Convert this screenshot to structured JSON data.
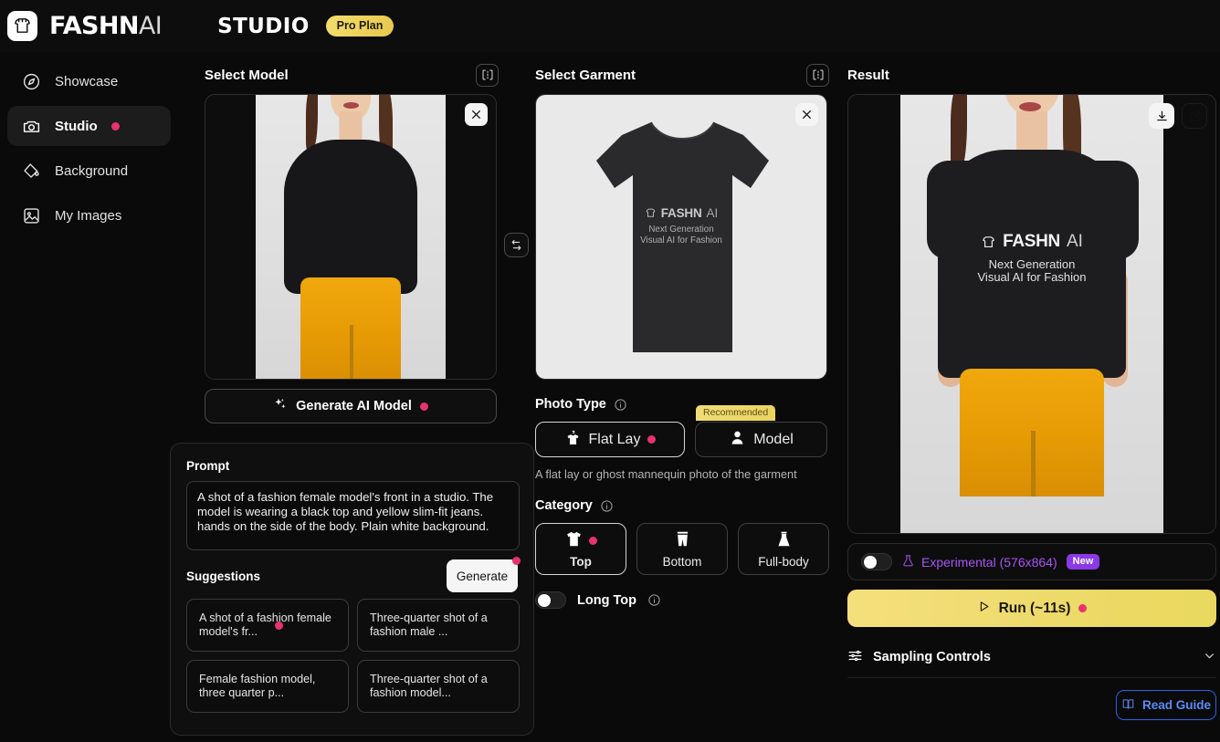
{
  "header": {
    "logo_icon": "shirt-logo-icon",
    "brand_bold": "FASHN",
    "brand_thin": "AI",
    "section": "STUDIO",
    "plan_badge": "Pro Plan"
  },
  "sidebar": {
    "items": [
      {
        "label": "Showcase",
        "icon": "compass-icon",
        "active": false,
        "dot": false
      },
      {
        "label": "Studio",
        "icon": "camera-icon",
        "active": true,
        "dot": true
      },
      {
        "label": "Background",
        "icon": "paint-bucket-icon",
        "active": false,
        "dot": false
      },
      {
        "label": "My Images",
        "icon": "image-icon",
        "active": false,
        "dot": false
      }
    ]
  },
  "model_panel": {
    "title": "Select Model",
    "frame_icon": "crop-frame-icon",
    "close_icon": "close-icon",
    "generate_button": "Generate AI Model",
    "sparkle_icon": "sparkles-icon"
  },
  "swap": {
    "icon": "swap-arrows-icon"
  },
  "prompt_panel": {
    "prompt_label": "Prompt",
    "prompt_value": "A shot of a fashion female model's front in a studio. The model is wearing a black top and yellow slim-fit jeans. hands on the side of the body. Plain white background.",
    "generate_label": "Generate",
    "suggestions_label": "Suggestions",
    "suggestions": [
      {
        "text": "A shot of a fashion female model's fr...",
        "dot": true
      },
      {
        "text": "Three-quarter shot of a fashion male ...",
        "dot": false
      },
      {
        "text": "Female fashion model, three quarter p...",
        "dot": false
      },
      {
        "text": "Three-quarter shot of a fashion model...",
        "dot": false
      }
    ]
  },
  "garment_panel": {
    "title": "Select Garment",
    "frame_icon": "crop-frame-icon",
    "close_icon": "close-icon",
    "garment_graphic": {
      "brand_bold": "FASHN",
      "brand_thin": "AI",
      "line1": "Next Generation",
      "line2": "Visual AI for Fashion"
    },
    "photo_type": {
      "label": "Photo Type",
      "info_icon": "info-icon",
      "options": [
        {
          "label": "Flat Lay",
          "icon": "hanger-shirt-icon",
          "selected": true,
          "dot": true,
          "tag": ""
        },
        {
          "label": "Model",
          "icon": "person-icon",
          "selected": false,
          "dot": false,
          "tag": "Recommended"
        }
      ],
      "helper": "A flat lay or ghost mannequin photo of the garment"
    },
    "category": {
      "label": "Category",
      "info_icon": "info-icon",
      "options": [
        {
          "label": "Top",
          "icon": "tshirt-icon",
          "selected": true,
          "dot": true
        },
        {
          "label": "Bottom",
          "icon": "shorts-icon",
          "selected": false,
          "dot": false
        },
        {
          "label": "Full-body",
          "icon": "dress-icon",
          "selected": false,
          "dot": false
        }
      ]
    },
    "long_top": {
      "label": "Long Top",
      "info_icon": "info-icon",
      "enabled": false
    }
  },
  "result_panel": {
    "title": "Result",
    "download_icon": "download-icon",
    "open_external_icon": "external-link-icon",
    "result_graphic": {
      "brand_bold": "FASHN",
      "brand_thin": "AI",
      "line1": "Next Generation",
      "line2": "Visual AI for Fashion"
    },
    "experimental": {
      "label": "Experimental (576x864)",
      "flask_icon": "flask-icon",
      "badge": "New",
      "enabled": false
    },
    "run_button": {
      "label": "Run (~11s)",
      "play_icon": "play-icon",
      "dot": true
    },
    "sampling_controls": {
      "label": "Sampling Controls",
      "sliders_icon": "sliders-icon",
      "chevron_icon": "chevron-down-icon"
    },
    "read_guide": {
      "label": "Read Guide",
      "icon": "book-icon"
    }
  },
  "colors": {
    "accent_pink": "#e8336d",
    "accent_yellow": "#ecd35c",
    "accent_purple": "#a855f7",
    "accent_blue": "#2563eb",
    "background": "#0a0a0a"
  }
}
